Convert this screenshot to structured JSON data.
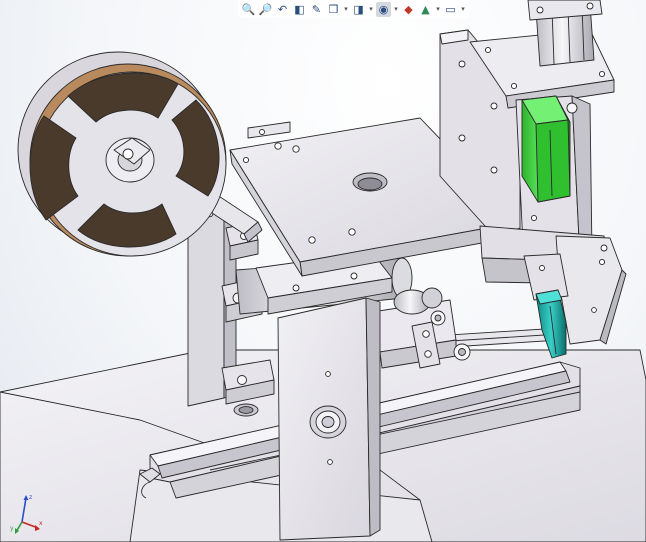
{
  "toolbar": {
    "items": [
      {
        "name": "zoom-to-fit-icon",
        "glyph": "🔍"
      },
      {
        "name": "zoom-to-area-icon",
        "glyph": "🔎"
      },
      {
        "name": "previous-view-icon",
        "glyph": "↶"
      },
      {
        "name": "section-view-icon",
        "glyph": "◧"
      },
      {
        "name": "dynamic-annotation-icon",
        "glyph": "✎"
      },
      {
        "name": "view-orientation-icon",
        "glyph": "❐"
      },
      {
        "name": "display-style-icon",
        "glyph": "◨"
      },
      {
        "name": "hide-show-items-icon",
        "glyph": "◉"
      },
      {
        "name": "edit-appearance-icon",
        "glyph": "◆"
      },
      {
        "name": "apply-scene-icon",
        "glyph": "▲"
      },
      {
        "name": "view-settings-icon",
        "glyph": "▭"
      }
    ]
  },
  "triad": {
    "x_label": "x",
    "y_label": "y",
    "z_label": "z"
  },
  "colors": {
    "part_face": "#e6e4ea",
    "part_light": "#f2f1f5",
    "part_dark": "#b9b6c0",
    "edge": "#2a2a2a",
    "reel_dark": "#4a3a2c",
    "reel_copper": "#b98a5e",
    "green_block": "#3fd63f",
    "teal_block": "#1aa7a0"
  }
}
